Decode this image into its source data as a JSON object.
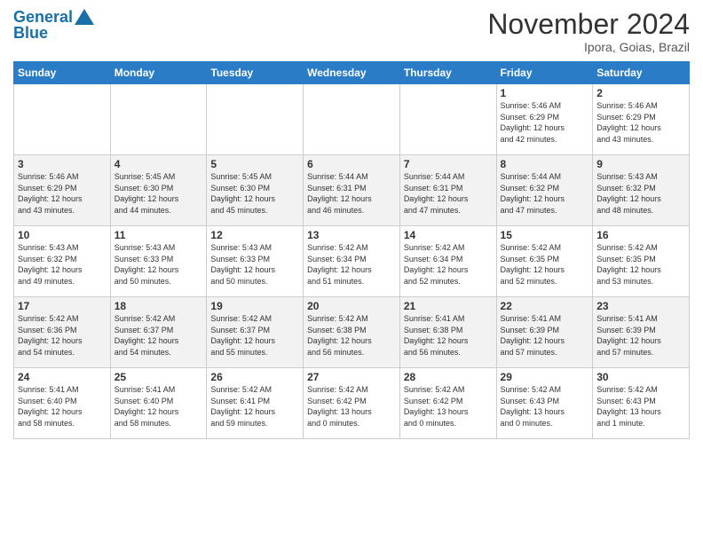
{
  "logo": {
    "line1": "General",
    "line2": "Blue"
  },
  "title": "November 2024",
  "location": "Ipora, Goias, Brazil",
  "weekdays": [
    "Sunday",
    "Monday",
    "Tuesday",
    "Wednesday",
    "Thursday",
    "Friday",
    "Saturday"
  ],
  "weeks": [
    [
      {
        "day": "",
        "detail": ""
      },
      {
        "day": "",
        "detail": ""
      },
      {
        "day": "",
        "detail": ""
      },
      {
        "day": "",
        "detail": ""
      },
      {
        "day": "",
        "detail": ""
      },
      {
        "day": "1",
        "detail": "Sunrise: 5:46 AM\nSunset: 6:29 PM\nDaylight: 12 hours\nand 42 minutes."
      },
      {
        "day": "2",
        "detail": "Sunrise: 5:46 AM\nSunset: 6:29 PM\nDaylight: 12 hours\nand 43 minutes."
      }
    ],
    [
      {
        "day": "3",
        "detail": "Sunrise: 5:46 AM\nSunset: 6:29 PM\nDaylight: 12 hours\nand 43 minutes."
      },
      {
        "day": "4",
        "detail": "Sunrise: 5:45 AM\nSunset: 6:30 PM\nDaylight: 12 hours\nand 44 minutes."
      },
      {
        "day": "5",
        "detail": "Sunrise: 5:45 AM\nSunset: 6:30 PM\nDaylight: 12 hours\nand 45 minutes."
      },
      {
        "day": "6",
        "detail": "Sunrise: 5:44 AM\nSunset: 6:31 PM\nDaylight: 12 hours\nand 46 minutes."
      },
      {
        "day": "7",
        "detail": "Sunrise: 5:44 AM\nSunset: 6:31 PM\nDaylight: 12 hours\nand 47 minutes."
      },
      {
        "day": "8",
        "detail": "Sunrise: 5:44 AM\nSunset: 6:32 PM\nDaylight: 12 hours\nand 47 minutes."
      },
      {
        "day": "9",
        "detail": "Sunrise: 5:43 AM\nSunset: 6:32 PM\nDaylight: 12 hours\nand 48 minutes."
      }
    ],
    [
      {
        "day": "10",
        "detail": "Sunrise: 5:43 AM\nSunset: 6:32 PM\nDaylight: 12 hours\nand 49 minutes."
      },
      {
        "day": "11",
        "detail": "Sunrise: 5:43 AM\nSunset: 6:33 PM\nDaylight: 12 hours\nand 50 minutes."
      },
      {
        "day": "12",
        "detail": "Sunrise: 5:43 AM\nSunset: 6:33 PM\nDaylight: 12 hours\nand 50 minutes."
      },
      {
        "day": "13",
        "detail": "Sunrise: 5:42 AM\nSunset: 6:34 PM\nDaylight: 12 hours\nand 51 minutes."
      },
      {
        "day": "14",
        "detail": "Sunrise: 5:42 AM\nSunset: 6:34 PM\nDaylight: 12 hours\nand 52 minutes."
      },
      {
        "day": "15",
        "detail": "Sunrise: 5:42 AM\nSunset: 6:35 PM\nDaylight: 12 hours\nand 52 minutes."
      },
      {
        "day": "16",
        "detail": "Sunrise: 5:42 AM\nSunset: 6:35 PM\nDaylight: 12 hours\nand 53 minutes."
      }
    ],
    [
      {
        "day": "17",
        "detail": "Sunrise: 5:42 AM\nSunset: 6:36 PM\nDaylight: 12 hours\nand 54 minutes."
      },
      {
        "day": "18",
        "detail": "Sunrise: 5:42 AM\nSunset: 6:37 PM\nDaylight: 12 hours\nand 54 minutes."
      },
      {
        "day": "19",
        "detail": "Sunrise: 5:42 AM\nSunset: 6:37 PM\nDaylight: 12 hours\nand 55 minutes."
      },
      {
        "day": "20",
        "detail": "Sunrise: 5:42 AM\nSunset: 6:38 PM\nDaylight: 12 hours\nand 56 minutes."
      },
      {
        "day": "21",
        "detail": "Sunrise: 5:41 AM\nSunset: 6:38 PM\nDaylight: 12 hours\nand 56 minutes."
      },
      {
        "day": "22",
        "detail": "Sunrise: 5:41 AM\nSunset: 6:39 PM\nDaylight: 12 hours\nand 57 minutes."
      },
      {
        "day": "23",
        "detail": "Sunrise: 5:41 AM\nSunset: 6:39 PM\nDaylight: 12 hours\nand 57 minutes."
      }
    ],
    [
      {
        "day": "24",
        "detail": "Sunrise: 5:41 AM\nSunset: 6:40 PM\nDaylight: 12 hours\nand 58 minutes."
      },
      {
        "day": "25",
        "detail": "Sunrise: 5:41 AM\nSunset: 6:40 PM\nDaylight: 12 hours\nand 58 minutes."
      },
      {
        "day": "26",
        "detail": "Sunrise: 5:42 AM\nSunset: 6:41 PM\nDaylight: 12 hours\nand 59 minutes."
      },
      {
        "day": "27",
        "detail": "Sunrise: 5:42 AM\nSunset: 6:42 PM\nDaylight: 13 hours\nand 0 minutes."
      },
      {
        "day": "28",
        "detail": "Sunrise: 5:42 AM\nSunset: 6:42 PM\nDaylight: 13 hours\nand 0 minutes."
      },
      {
        "day": "29",
        "detail": "Sunrise: 5:42 AM\nSunset: 6:43 PM\nDaylight: 13 hours\nand 0 minutes."
      },
      {
        "day": "30",
        "detail": "Sunrise: 5:42 AM\nSunset: 6:43 PM\nDaylight: 13 hours\nand 1 minute."
      }
    ]
  ]
}
